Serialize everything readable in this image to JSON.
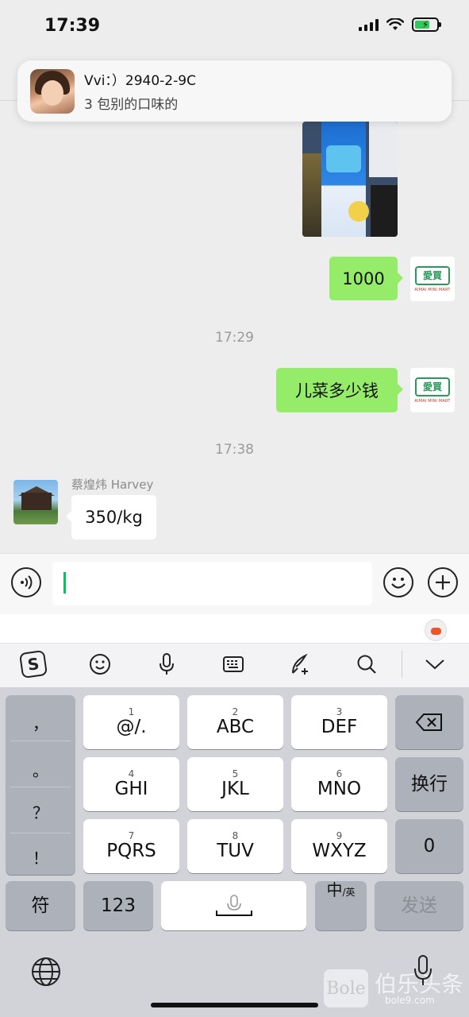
{
  "status_bar": {
    "time": "17:39"
  },
  "notification": {
    "title": "Vvi：）2940-2-9C",
    "body": "3 包别的口味的"
  },
  "messages": {
    "m1_text": "1000",
    "t1": "17:29",
    "m2_text": "儿菜多少钱",
    "t2": "17:38",
    "m3_sender": "蔡煌炜 Harvey",
    "m3_text": "350/kg"
  },
  "shop_avatar": {
    "logo": "愛買",
    "sub": "AIMAI MINI MART"
  },
  "input": {
    "value": ""
  },
  "ime_toolbar": {
    "sogou": "S",
    "icons": [
      "sogou-icon",
      "emoji-icon",
      "microphone-icon",
      "keyboard-icon",
      "handwriting-icon",
      "search-icon",
      "collapse-icon"
    ]
  },
  "keyboard": {
    "symbols": [
      "，",
      "。",
      "？",
      "！"
    ],
    "row1": [
      {
        "num": "1",
        "label": "@/."
      },
      {
        "num": "2",
        "label": "ABC"
      },
      {
        "num": "3",
        "label": "DEF"
      }
    ],
    "row2": [
      {
        "num": "4",
        "label": "GHI"
      },
      {
        "num": "5",
        "label": "JKL"
      },
      {
        "num": "6",
        "label": "MNO"
      }
    ],
    "row3": [
      {
        "num": "7",
        "label": "PQRS"
      },
      {
        "num": "8",
        "label": "TUV"
      },
      {
        "num": "9",
        "label": "WXYZ"
      }
    ],
    "delete_icon": "backspace-icon",
    "newline": "换行",
    "zero": "0",
    "fu": "符",
    "num123": "123",
    "lang_main": "中",
    "lang_sub": "/英",
    "send": "发送"
  },
  "watermark": {
    "logo": "Bole",
    "text": "伯乐头条",
    "domain": "bole9.com"
  },
  "colors": {
    "bubble_out": "#95ec69",
    "caret": "#07c160",
    "chat_bg": "#ededed"
  }
}
